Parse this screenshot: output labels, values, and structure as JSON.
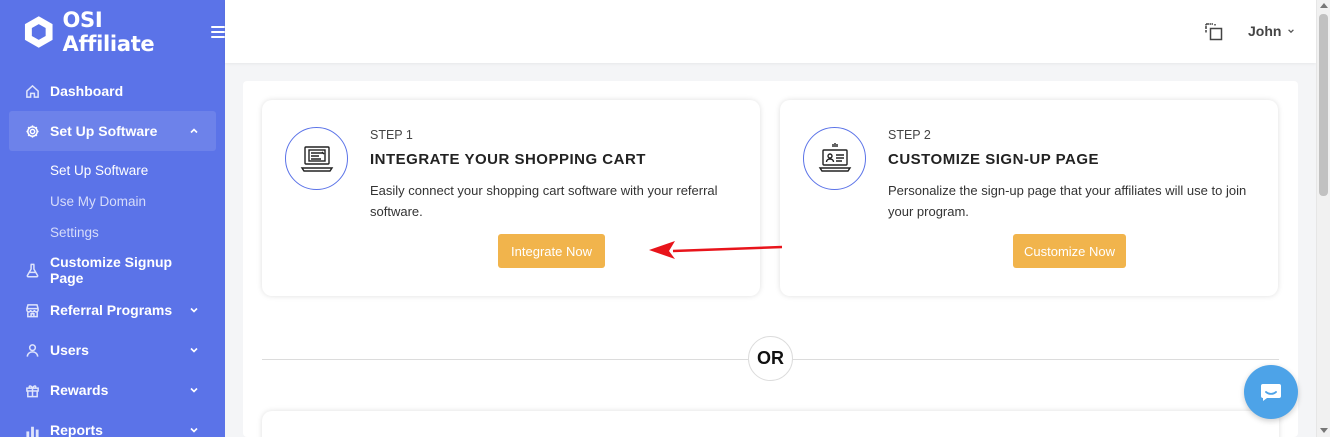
{
  "app": {
    "name": "OSI Affiliate"
  },
  "sidebar": {
    "items": [
      {
        "label": "Dashboard",
        "icon": "home-icon"
      },
      {
        "label": "Set Up Software",
        "icon": "gear-icon",
        "expanded": true,
        "children": [
          "Set Up Software",
          "Use My Domain",
          "Settings"
        ]
      },
      {
        "label": "Customize Signup Page",
        "icon": "flask-icon"
      },
      {
        "label": "Referral Programs",
        "icon": "store-icon"
      },
      {
        "label": "Users",
        "icon": "user-icon"
      },
      {
        "label": "Rewards",
        "icon": "gift-icon"
      },
      {
        "label": "Reports",
        "icon": "bar-chart-icon"
      }
    ],
    "accent": "#5b73e8"
  },
  "header": {
    "user_name": "John"
  },
  "steps": [
    {
      "step": "STEP 1",
      "title": "INTEGRATE YOUR SHOPPING CART",
      "description": "Easily connect your shopping cart software with your referral software.",
      "button": "Integrate Now",
      "icon": "laptop-cart-icon"
    },
    {
      "step": "STEP 2",
      "title": "CUSTOMIZE SIGN-UP PAGE",
      "description": "Personalize the sign-up page that your affiliates will use to join your program.",
      "button": "Customize Now",
      "icon": "laptop-profile-icon"
    }
  ],
  "divider_text": "OR",
  "colors": {
    "button": "#f1b44c",
    "arrow": "#e8141b",
    "chat": "#4da3e8"
  }
}
